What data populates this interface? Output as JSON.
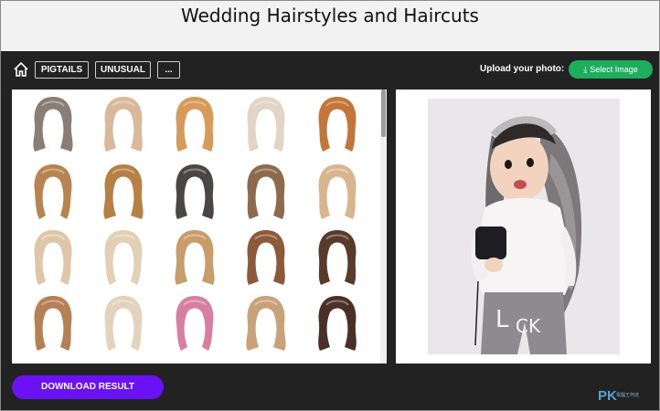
{
  "header": {
    "title": "Wedding Hairstyles and Haircuts"
  },
  "toolbar": {
    "chips": [
      {
        "label": "PIGTAILS"
      },
      {
        "label": "UNUSUAL"
      },
      {
        "label": "..."
      }
    ],
    "upload_label": "Upload your photo:",
    "select_label": "Select Image"
  },
  "gallery": {
    "hair_colors": [
      "#8a7e74",
      "#d9b99a",
      "#d89a5a",
      "#e2d5c5",
      "#c2763a",
      "#b7834e",
      "#b78045",
      "#4a4646",
      "#8e6a4c",
      "#d9b58e",
      "#e0c6a8",
      "#e2cfb4",
      "#c99d6a",
      "#8c5a3a",
      "#5a3a2a",
      "#b58055",
      "#e4d2bc",
      "#d87fa0",
      "#c8a27a",
      "#4a3026"
    ]
  },
  "footer": {
    "download_label": "DOWNLOAD RESULT",
    "watermark": "PK",
    "watermark_sub": "電腦王阿達"
  },
  "colors": {
    "accent_green": "#1cae5c",
    "accent_purple": "#6a11f5",
    "toolbar_bg": "#222222"
  }
}
